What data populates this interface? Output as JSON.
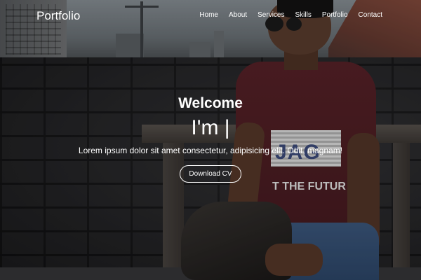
{
  "nav": {
    "brand": "Portfolio",
    "links": [
      "Home",
      "About",
      "Services",
      "Skills",
      "Portfolio",
      "Contact"
    ]
  },
  "hero": {
    "welcome": "Welcome",
    "typed": "I'm |",
    "description": "Lorem ipsum dolor sit amet consectetur, adipisicing elit. Odit, magnam!",
    "cta_label": "Download CV"
  },
  "background_photo": {
    "shirt_print": "JAG",
    "shirt_slogan": "T THE FUTUR"
  },
  "colors": {
    "text": "#ffffff",
    "overlay": "#000000"
  },
  "icons": [
    "none"
  ]
}
